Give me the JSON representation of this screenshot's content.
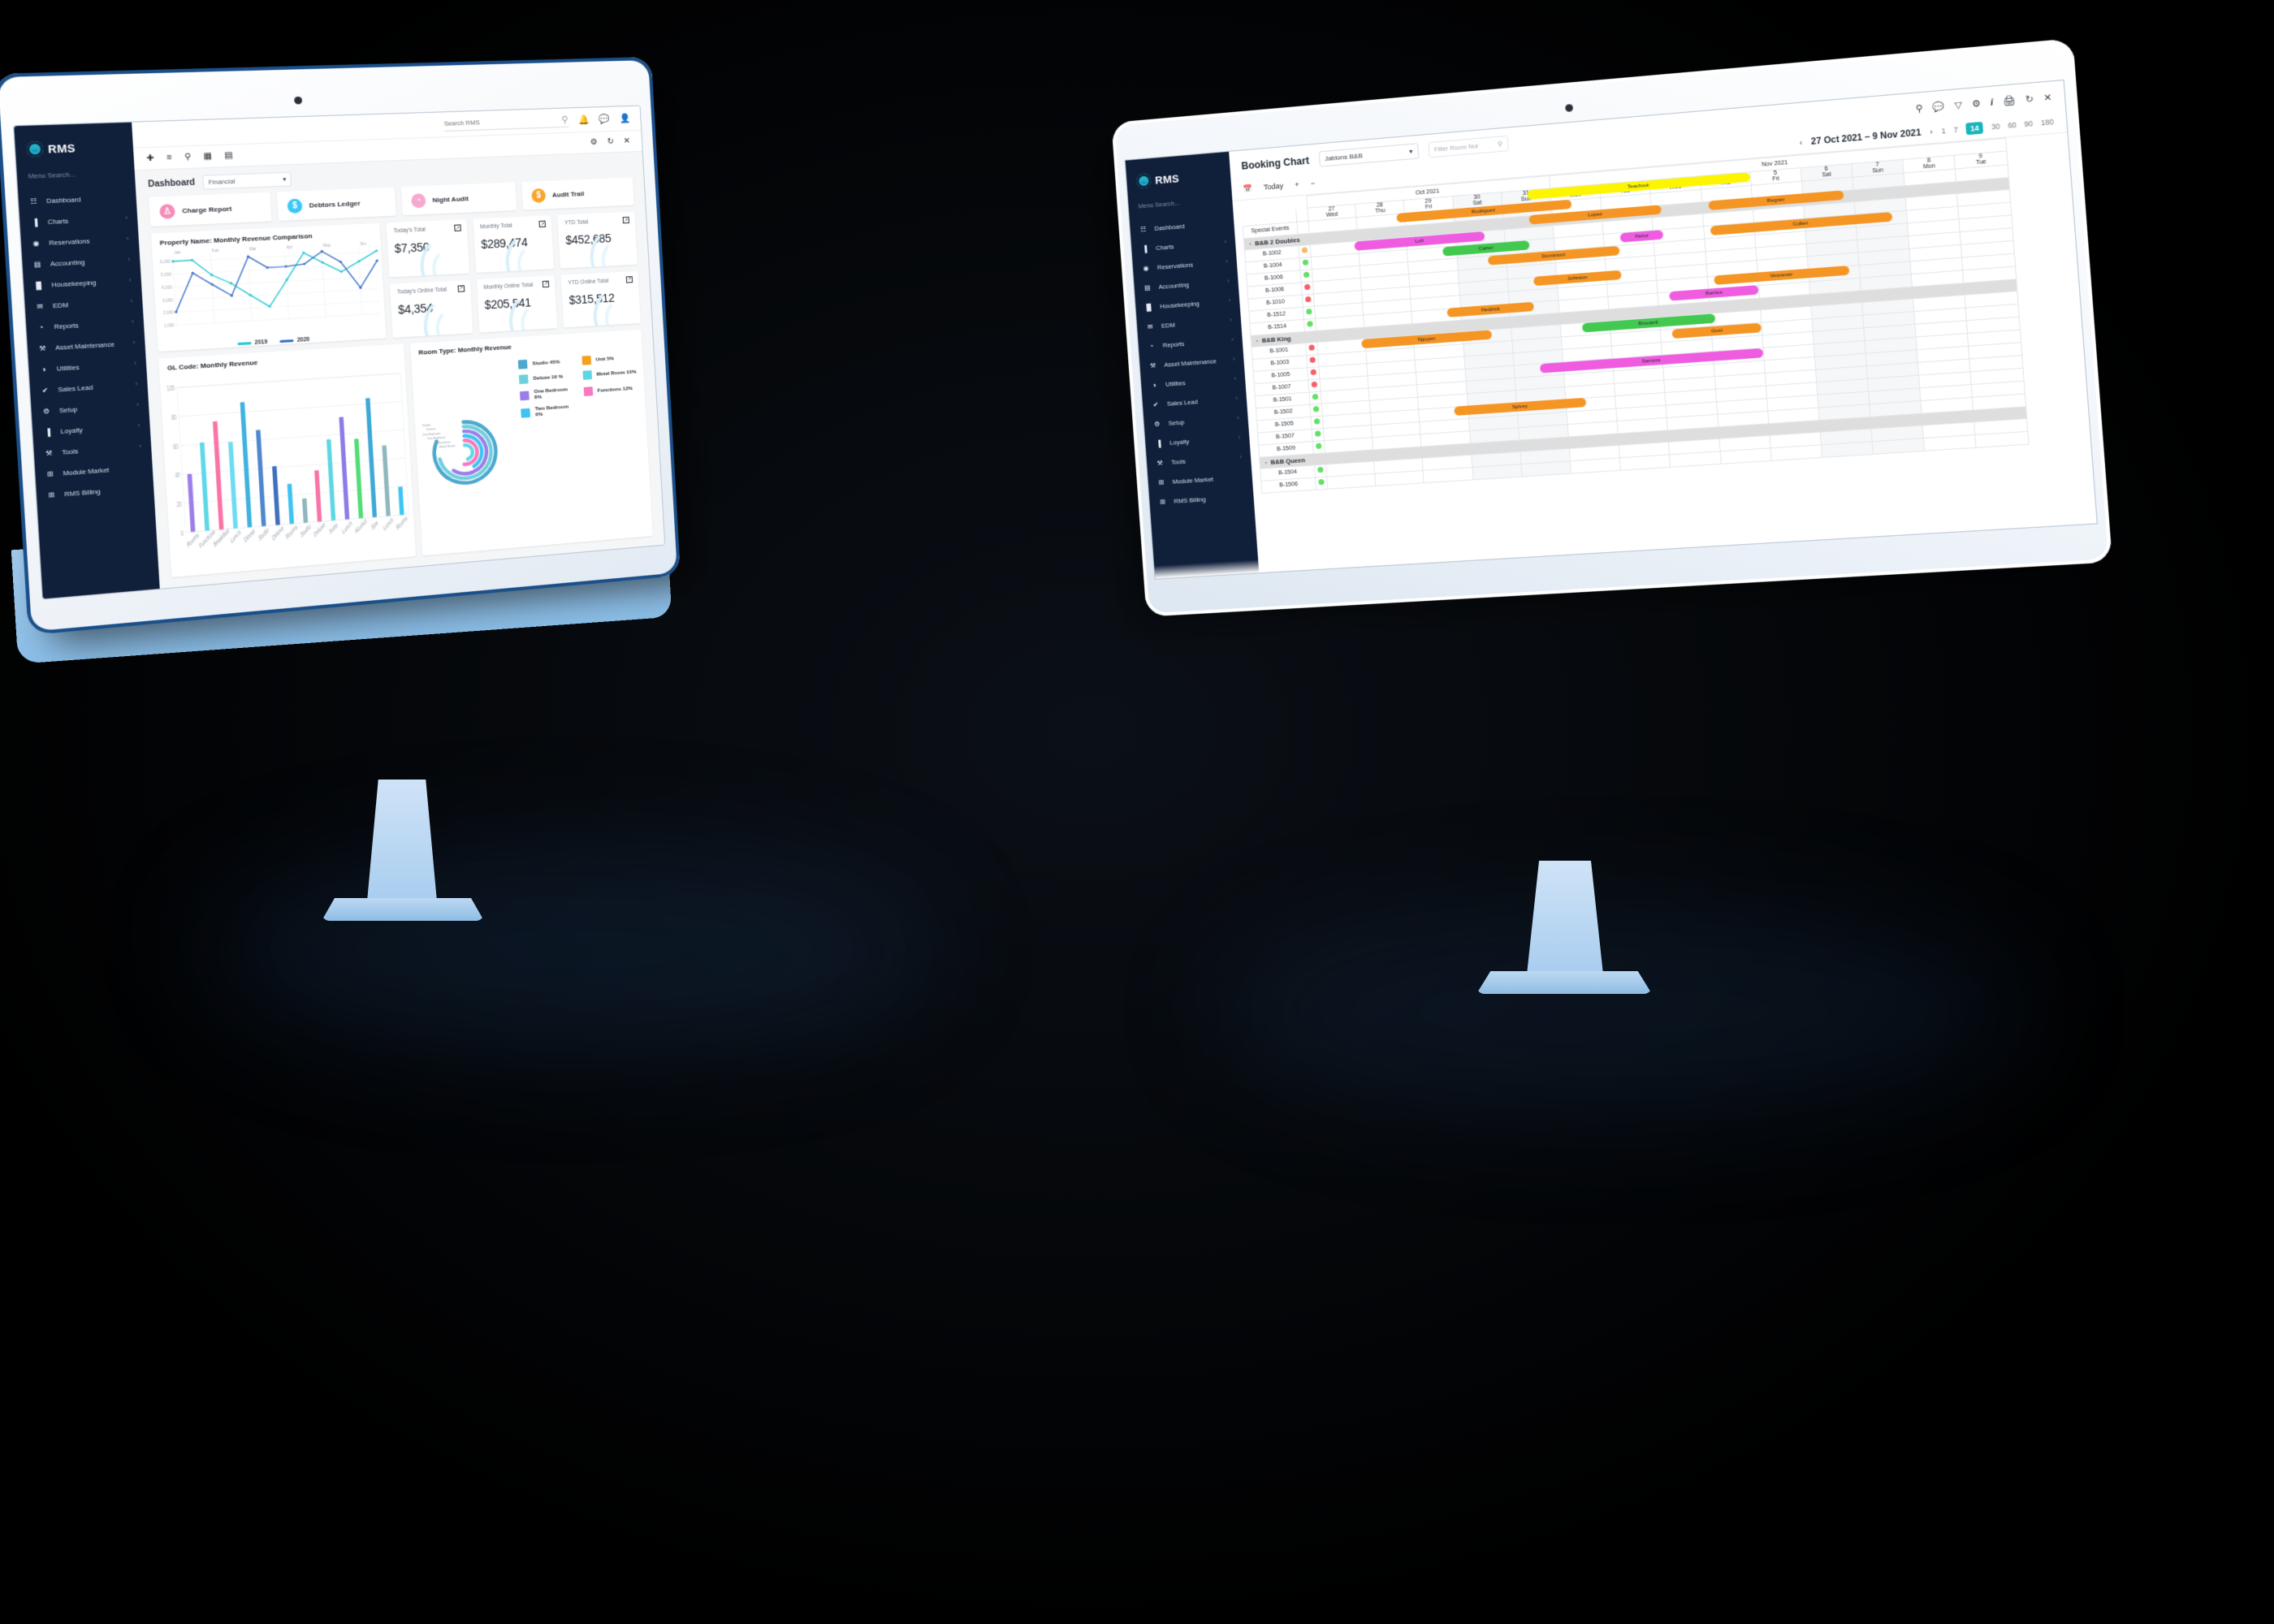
{
  "left_window": {
    "brand": "RMS",
    "menu_search_placeholder": "Menu Search...",
    "search_placeholder": "Search RMS",
    "sidebar_items": [
      {
        "label": "Dashboard",
        "icon": "grid-icon",
        "chevron": ""
      },
      {
        "label": "Charts",
        "icon": "bar-chart-icon",
        "chevron": "›"
      },
      {
        "label": "Reservations",
        "icon": "location-pin-icon",
        "chevron": "›"
      },
      {
        "label": "Accounting",
        "icon": "card-icon",
        "chevron": "›"
      },
      {
        "label": "Housekeeping",
        "icon": "bed-icon",
        "chevron": "›"
      },
      {
        "label": "EDM",
        "icon": "envelope-icon",
        "chevron": "›"
      },
      {
        "label": "Reports",
        "icon": "pie-chart-icon",
        "chevron": "›"
      },
      {
        "label": "Asset Maintenance",
        "icon": "toolbox-icon",
        "chevron": "›"
      },
      {
        "label": "Utilities",
        "icon": "gauge-icon",
        "chevron": "›"
      },
      {
        "label": "Sales Lead",
        "icon": "check-circle-icon",
        "chevron": "›"
      },
      {
        "label": "Setup",
        "icon": "gear-icon",
        "chevron": "›"
      },
      {
        "label": "Loyalty",
        "icon": "tag-icon",
        "chevron": "›"
      },
      {
        "label": "Tools",
        "icon": "tools-icon",
        "chevron": "›"
      },
      {
        "label": "Module Market",
        "icon": "plus-box-icon",
        "chevron": ""
      },
      {
        "label": "RMS Billing",
        "icon": "plus-box-icon",
        "chevron": ""
      }
    ],
    "dashboard_label": "Dashboard",
    "dashboard_selected": "Financial",
    "tiles": [
      {
        "label": "Charge Report",
        "icon": "person-icon",
        "color": "#f58cba",
        "glyph": "♙"
      },
      {
        "label": "Debtors Ledger",
        "icon": "dollar-icon",
        "color": "#3cc8f5",
        "glyph": "$"
      },
      {
        "label": "Night Audit",
        "icon": "clock-icon",
        "color": "#f7a8cf",
        "glyph": "◔"
      },
      {
        "label": "Audit Trail",
        "icon": "dollar-icon",
        "color": "#f9a52b",
        "glyph": "$"
      }
    ],
    "kpis": [
      {
        "label": "Today's Total",
        "value": "$7,350"
      },
      {
        "label": "Monthly Total",
        "value": "$289,474"
      },
      {
        "label": "YTD Total",
        "value": "$452,685"
      },
      {
        "label": "Today's Online Total",
        "value": "$4,354"
      },
      {
        "label": "Monthly Online Total",
        "value": "$205,541"
      },
      {
        "label": "YTD Online Total",
        "value": "$315,512"
      }
    ],
    "line_panel_title": "Property Name: Monthly Revenue Comparison",
    "bar_panel_title": "GL Code: Monthly Revenue",
    "donut_panel_title": "Room Type: Monthly Revenue"
  },
  "chart_data": [
    {
      "type": "line",
      "title": "Property Name: Monthly Revenue Comparison",
      "xlabel": "",
      "ylabel": "",
      "categories": [
        "Jan",
        "",
        "Feb",
        "",
        "Mar",
        "",
        "Apr",
        "",
        "May",
        "",
        "Jun",
        ""
      ],
      "x_tick_labels": [
        "Jan",
        "Feb",
        "Mar",
        "Apr",
        "May",
        "Jun"
      ],
      "y_tick_labels": [
        "1,000",
        "2,000",
        "3,000",
        "4,000",
        "5,000",
        "6,000"
      ],
      "ylim": [
        1000,
        6500
      ],
      "grid": true,
      "legend_position": "bottom",
      "series": [
        {
          "name": "2019",
          "color": "#2ec8d3",
          "values": [
            6020,
            6050,
            4800,
            4070,
            3040,
            2060,
            4100,
            6200,
            5350,
            4540,
            5300,
            6080
          ]
        },
        {
          "name": "2020",
          "color": "#3f72c9",
          "values": [
            2030,
            5030,
            4040,
            3080,
            6110,
            5160,
            5180,
            5300,
            6240,
            5320,
            3170,
            5280
          ]
        }
      ]
    },
    {
      "type": "bar",
      "title": "GL Code: Monthly Revenue",
      "xlabel": "",
      "ylabel": "",
      "ylim": [
        0,
        100
      ],
      "y_tick_labels": [
        "0",
        "20",
        "40",
        "60",
        "80",
        "100"
      ],
      "grid": true,
      "categories": [
        "Rooms",
        "Functions",
        "Breakfast",
        "Lunch",
        "Dinner",
        "Studio",
        "Deluxe",
        "Rooms",
        "Studio",
        "Deluxe",
        "Suite",
        "Lunch",
        "Alcohol",
        "Spa",
        "Lunch",
        "Rooms"
      ],
      "values": [
        40,
        61,
        75,
        60,
        87,
        67,
        41,
        28,
        17,
        36,
        57,
        72,
        56,
        84,
        50,
        20
      ],
      "colors": [
        "#9b7ee8",
        "#5ed8e8",
        "#f974a6",
        "#6ddcf2",
        "#3fb3e0",
        "#4f87cf",
        "#4070bd",
        "#3fc4f2",
        "#8fb7bd",
        "#f974a6",
        "#5fd7e3",
        "#8f7ae8",
        "#54dc76",
        "#3ea9d6",
        "#8fb7bd",
        "#3fc4f2"
      ]
    },
    {
      "type": "pie",
      "subtype": "radial-bar",
      "title": "Room Type: Monthly Revenue",
      "labels": [
        "Studio",
        "Deluxe",
        "One Bedroom",
        "Two Bedroom",
        "Functions",
        "Motel Room"
      ],
      "legend": [
        {
          "label": "Studio 45%",
          "value": 45,
          "color": "#4da8cf"
        },
        {
          "label": "Deluxe 16 %",
          "value": 16,
          "color": "#6fd0dc"
        },
        {
          "label": "One Bedroom 8%",
          "value": 8,
          "color": "#9b7ee8"
        },
        {
          "label": "Two Bedroom 6%",
          "value": 6,
          "color": "#3fc4f2"
        },
        {
          "label": "Unit 5%",
          "value": 5,
          "color": "#f4a020"
        },
        {
          "label": "Motel Room 10%",
          "value": 10,
          "color": "#5fd7e3"
        },
        {
          "label": "Functions 12%",
          "value": 12,
          "color": "#f779c0"
        }
      ]
    }
  ],
  "right_window": {
    "brand": "RMS",
    "menu_search_placeholder": "Menu Search...",
    "title": "Booking Chart",
    "property_selected": "Jablons B&B",
    "filter_placeholder": "Filter Room Nur",
    "header_icons": [
      "key-icon",
      "chat-icon",
      "filter-icon",
      "gear-icon",
      "info-icon",
      "print-icon",
      "refresh-icon",
      "close-icon"
    ],
    "toolbar": {
      "calendar_icon": "calendar-icon",
      "today_label": "Today",
      "zoom_in": "+",
      "zoom_out": "−",
      "prev": "‹",
      "next": "›",
      "date_range": "27 Oct 2021 – 9 Nov 2021",
      "day_options": [
        "1",
        "7",
        "14",
        "30",
        "60",
        "90",
        "180"
      ],
      "day_selected": "14"
    },
    "month_headers": [
      {
        "label": "Oct 2021",
        "span": 5
      },
      {
        "label": "Nov 2021",
        "span": 9
      }
    ],
    "days": [
      {
        "num": "27",
        "dow": "Wed",
        "weekend": false
      },
      {
        "num": "28",
        "dow": "Thu",
        "weekend": false
      },
      {
        "num": "29",
        "dow": "Fri",
        "weekend": false
      },
      {
        "num": "30",
        "dow": "Sat",
        "weekend": true
      },
      {
        "num": "31",
        "dow": "Sun",
        "weekend": true
      },
      {
        "num": "1",
        "dow": "Mon",
        "weekend": false
      },
      {
        "num": "2",
        "dow": "Tue",
        "weekend": false
      },
      {
        "num": "3",
        "dow": "Wed",
        "weekend": false
      },
      {
        "num": "4",
        "dow": "Thu",
        "weekend": false
      },
      {
        "num": "5",
        "dow": "Fri",
        "weekend": false
      },
      {
        "num": "6",
        "dow": "Sat",
        "weekend": true
      },
      {
        "num": "7",
        "dow": "Sun",
        "weekend": true
      },
      {
        "num": "8",
        "dow": "Mon",
        "weekend": false
      },
      {
        "num": "9",
        "dow": "Tue",
        "weekend": false
      }
    ],
    "special_events_label": "Special Events",
    "groups": [
      {
        "name": "B&B 2 Doubles",
        "rows": [
          {
            "room": "B-1002",
            "status": "#f9b96a",
            "bookings": []
          },
          {
            "room": "B-1004",
            "status": "#61e067",
            "bookings": [
              {
                "name": "Teachout",
                "color": "#fdf500",
                "start": 5,
                "span": 5
              }
            ]
          },
          {
            "room": "B-1006",
            "status": "#61e067",
            "bookings": [
              {
                "name": "Rodriguez",
                "color": "#f59524",
                "start": 2,
                "span": 4
              }
            ]
          },
          {
            "room": "B-1008",
            "status": "#f4606a",
            "bookings": [
              {
                "name": "Lopez",
                "color": "#f59524",
                "start": 5,
                "span": 3
              },
              {
                "name": "Regner",
                "color": "#f59524",
                "start": 9,
                "span": 3
              }
            ]
          },
          {
            "room": "B-1010",
            "status": "#f4606a",
            "bookings": [
              {
                "name": "Loft",
                "color": "#ef5ce0",
                "start": 1,
                "span": 3
              }
            ]
          },
          {
            "room": "B-1512",
            "status": "#61e067",
            "bookings": [
              {
                "name": "Carter",
                "color": "#43c94f",
                "start": 3,
                "span": 2
              },
              {
                "name": "Heinz",
                "color": "#ef5ce0",
                "start": 7,
                "span": 1
              },
              {
                "name": "Cullen",
                "color": "#f59524",
                "start": 9,
                "span": 4
              }
            ]
          },
          {
            "room": "B-1514",
            "status": "#61e067",
            "bookings": [
              {
                "name": "Dominioni",
                "color": "#f59524",
                "start": 4,
                "span": 3
              }
            ]
          }
        ]
      },
      {
        "name": "B&B King",
        "rows": [
          {
            "room": "B-1001",
            "status": "#f4606a",
            "bookings": [
              {
                "name": "Johnson",
                "color": "#f59524",
                "start": 5,
                "span": 2
              }
            ]
          },
          {
            "room": "B-1003",
            "status": "#f4606a",
            "bookings": [
              {
                "name": "Vesnever",
                "color": "#f59524",
                "start": 9,
                "span": 3
              }
            ]
          },
          {
            "room": "B-1005",
            "status": "#f4606a",
            "bookings": [
              {
                "name": "Heidrick",
                "color": "#f59524",
                "start": 3,
                "span": 2
              },
              {
                "name": "Barrios",
                "color": "#ef5ce0",
                "start": 8,
                "span": 2
              }
            ]
          },
          {
            "room": "B-1007",
            "status": "#f4606a",
            "bookings": []
          },
          {
            "room": "B-1501",
            "status": "#61e067",
            "bookings": [
              {
                "name": "Nguyen",
                "color": "#f59524",
                "start": 1,
                "span": 3
              },
              {
                "name": "Brucanti",
                "color": "#43c94f",
                "start": 6,
                "span": 3
              }
            ]
          },
          {
            "room": "B-1502",
            "status": "#61e067",
            "bookings": [
              {
                "name": "Gust",
                "color": "#f59524",
                "start": 8,
                "span": 2
              }
            ]
          },
          {
            "room": "B-1505",
            "status": "#61e067",
            "bookings": []
          },
          {
            "room": "B-1507",
            "status": "#61e067",
            "bookings": [
              {
                "name": "Samora",
                "color": "#ef5ce0",
                "start": 5,
                "span": 5
              }
            ]
          },
          {
            "room": "B-1509",
            "status": "#61e067",
            "bookings": []
          }
        ]
      },
      {
        "name": "B&B Queen",
        "rows": [
          {
            "room": "B-1504",
            "status": "#61e067",
            "bookings": [
              {
                "name": "Spivey",
                "color": "#f59524",
                "start": 3,
                "span": 3
              }
            ]
          },
          {
            "room": "B-1506",
            "status": "#61e067",
            "bookings": []
          }
        ]
      }
    ]
  }
}
